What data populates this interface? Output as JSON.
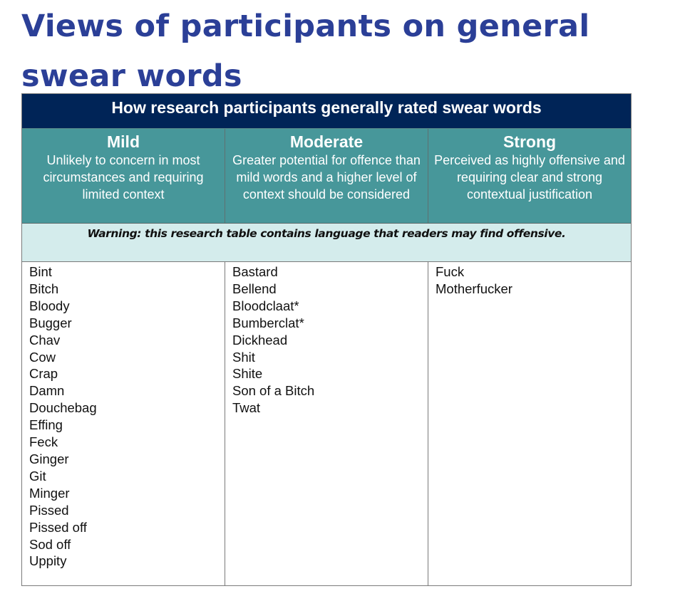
{
  "document": {
    "title_line1": "Views of participants on general",
    "title_line2": "swear words"
  },
  "table": {
    "banner": "How research participants generally rated swear words",
    "warning": "Warning: this research table contains language that readers may find offensive.",
    "columns": [
      {
        "name": "Mild",
        "description": "Unlikely to concern in most circumstances and requiring limited context",
        "words": [
          "Bint",
          "Bitch",
          "Bloody",
          "Bugger",
          "Chav",
          "Cow",
          "Crap",
          "Damn",
          "Douchebag",
          "Effing",
          "Feck",
          "Ginger",
          "Git",
          "Minger",
          "Pissed",
          "Pissed off",
          "Sod off",
          "Uppity"
        ]
      },
      {
        "name": "Moderate",
        "description": "Greater potential for offence than mild words and a higher level of context should be considered",
        "words": [
          "Bastard",
          "Bellend",
          "Bloodclaat*",
          "Bumberclat*",
          "Dickhead",
          "Shit",
          "Shite",
          "Son of a Bitch",
          "Twat"
        ]
      },
      {
        "name": "Strong",
        "description": "Perceived as highly offensive and requiring clear and strong contextual justification",
        "words": [
          "Fuck",
          "Motherfucker"
        ]
      }
    ]
  },
  "colors": {
    "title": "#2b3f97",
    "banner_bg": "#002457",
    "header_bg": "#47979a",
    "warning_bg": "#d4ecec"
  }
}
